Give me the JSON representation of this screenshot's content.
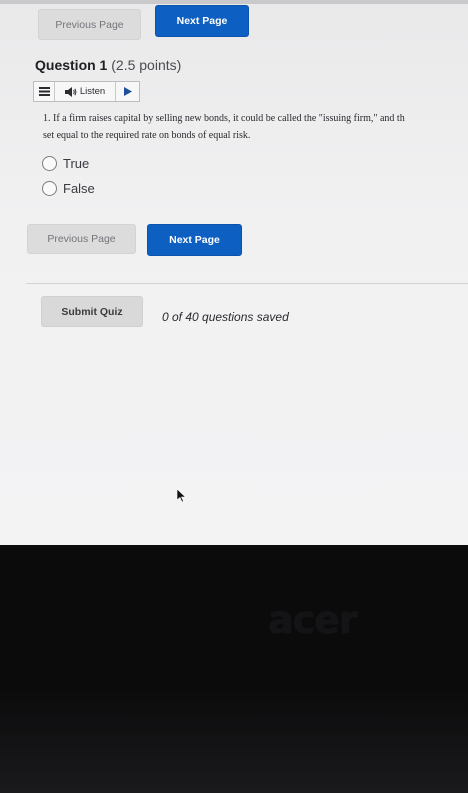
{
  "nav": {
    "previous_label": "Previous Page",
    "next_label": "Next Page"
  },
  "question": {
    "number_label": "Question 1",
    "points_label": "(2.5 points)",
    "text_line1": "1. If a firm raises capital by selling new bonds, it could be called the \"issuing firm,\" and th",
    "text_line2": "set equal to the required rate on bonds of equal risk.",
    "options": [
      "True",
      "False"
    ]
  },
  "listen": {
    "label": "Listen"
  },
  "footer": {
    "submit_label": "Submit Quiz",
    "saved_status": "0 of 40 questions saved"
  },
  "bezel": {
    "brand": "acer"
  },
  "colors": {
    "accent": "#0e5fc2",
    "page_bg": "#f1f1f2",
    "bezel": "#0b0b0c"
  }
}
